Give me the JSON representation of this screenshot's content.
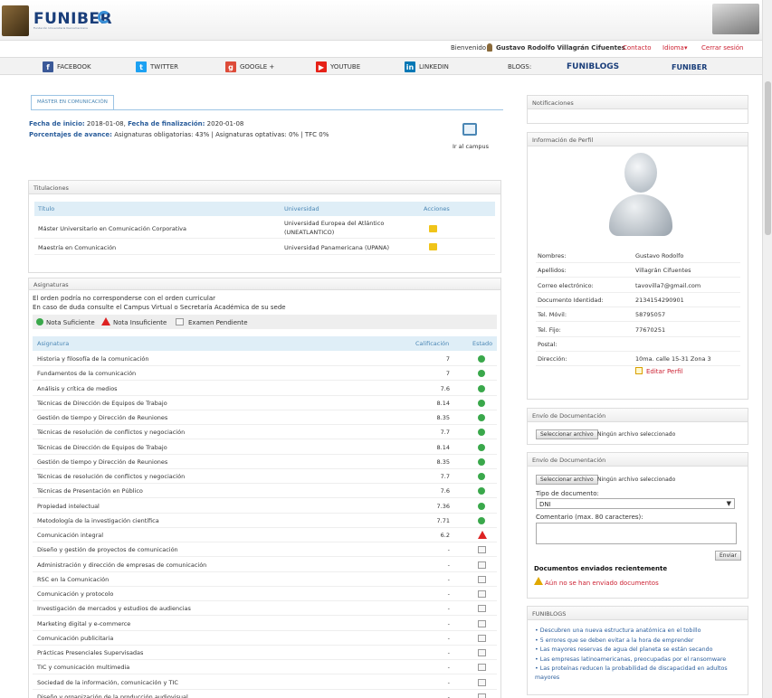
{
  "header": {
    "logo": "FUNIBER",
    "logo_sub": "Fundación Universitaria Iberoamericana",
    "welcome": "Bienvenido",
    "user": "Gustavo Rodolfo Villagrán Cifuentes",
    "contact": "Contacto",
    "language": "Idioma",
    "logout": "Cerrar sesión"
  },
  "social": {
    "facebook": "FACEBOOK",
    "twitter": "TWITTER",
    "google": "GOOGLE +",
    "youtube": "YOUTUBE",
    "linkedin": "LINKEDIN",
    "blogs": "BLOGS:",
    "funiblogs": "FUNIBLOGS",
    "funiber": "FUNIBER"
  },
  "program": {
    "tab": "MÁSTER EN COMUNICACIÓN",
    "start_label": "Fecha de inicio:",
    "start": "2018-01-08,",
    "end_label": "Fecha de finalización:",
    "end": "2020-01-08",
    "progress_label": "Porcentajes de avance:",
    "progress": "Asignaturas obligatorias: 43% | Asignaturas optativas: 0% | TFC 0%",
    "campus": "Ir al campus"
  },
  "titulaciones": {
    "title": "Titulaciones",
    "headers": [
      "Título",
      "Universidad",
      "Acciones"
    ],
    "rows": [
      {
        "titulo": "Máster Universitario en Comunicación Corporativa",
        "uni1": "Universidad Europea del Atlántico",
        "uni2": "(UNEATLANTICO)"
      },
      {
        "titulo": "Maestría en Comunicación",
        "uni1": "Universidad Panamericana (UPANA)",
        "uni2": ""
      }
    ]
  },
  "asignaturas": {
    "title": "Asignaturas",
    "note1": "El orden podría no corresponderse con el orden curricular",
    "note2": "En caso de duda consulte el Campus Virtual o Secretaría Académica de su sede",
    "legend_ok": "Nota Suficiente",
    "legend_bad": "Nota Insuficiente",
    "legend_pend": "Examen Pendiente",
    "headers": [
      "Asignatura",
      "Calificación",
      "Estado"
    ],
    "rows": [
      {
        "name": "Historia y filosofía de la comunicación",
        "grade": "7",
        "status": "ok"
      },
      {
        "name": "Fundamentos de la comunicación",
        "grade": "7",
        "status": "ok"
      },
      {
        "name": "Análisis y crítica de medios",
        "grade": "7.6",
        "status": "ok"
      },
      {
        "name": "Técnicas de Dirección de Equipos de Trabajo",
        "grade": "8.14",
        "status": "ok"
      },
      {
        "name": "Gestión de tiempo y Dirección de Reuniones",
        "grade": "8.35",
        "status": "ok"
      },
      {
        "name": "Técnicas de resolución de conflictos y negociación",
        "grade": "7.7",
        "status": "ok"
      },
      {
        "name": "Técnicas de Dirección de Equipos de Trabajo",
        "grade": "8.14",
        "status": "ok"
      },
      {
        "name": "Gestión de tiempo y Dirección de Reuniones",
        "grade": "8.35",
        "status": "ok"
      },
      {
        "name": "Técnicas de resolución de conflictos y negociación",
        "grade": "7.7",
        "status": "ok"
      },
      {
        "name": "Técnicas de Presentación en Público",
        "grade": "7.6",
        "status": "ok"
      },
      {
        "name": "Propiedad intelectual",
        "grade": "7.36",
        "status": "ok"
      },
      {
        "name": "Metodología de la investigación científica",
        "grade": "7.71",
        "status": "ok"
      },
      {
        "name": "Comunicación integral",
        "grade": "6.2",
        "status": "bad"
      },
      {
        "name": "Diseño y gestión de proyectos de comunicación",
        "grade": "-",
        "status": "pend"
      },
      {
        "name": "Administración y dirección de empresas de comunicación",
        "grade": "-",
        "status": "pend"
      },
      {
        "name": "RSC en la Comunicación",
        "grade": "-",
        "status": "pend"
      },
      {
        "name": "Comunicación y protocolo",
        "grade": "-",
        "status": "pend"
      },
      {
        "name": "Investigación de mercados y estudios de audiencias",
        "grade": "-",
        "status": "pend"
      },
      {
        "name": "Marketing digital y e-commerce",
        "grade": "-",
        "status": "pend"
      },
      {
        "name": "Comunicación publicitaria",
        "grade": "-",
        "status": "pend"
      },
      {
        "name": "Prácticas Presenciales Supervisadas",
        "grade": "-",
        "status": "pend"
      },
      {
        "name": "TIC y comunicación multimedia",
        "grade": "-",
        "status": "pend"
      },
      {
        "name": "Sociedad de la información, comunicación y TIC",
        "grade": "-",
        "status": "pend"
      },
      {
        "name": "Diseño y organización de la producción audiovisual",
        "grade": "-",
        "status": "pend"
      }
    ]
  },
  "notificaciones": {
    "title": "Notificaciones"
  },
  "perfil": {
    "title": "Información de Perfil",
    "fields": [
      {
        "label": "Nombres:",
        "value": "Gustavo Rodolfo"
      },
      {
        "label": "Apellidos:",
        "value": "Villagrán Cifuentes"
      },
      {
        "label": "Correo electrónico:",
        "value": "tavovilla7@gmail.com"
      },
      {
        "label": "Documento Identidad:",
        "value": "2134154290901"
      },
      {
        "label": "Tel. Móvil:",
        "value": "58795057"
      },
      {
        "label": "Tel. Fijo:",
        "value": "77670251"
      },
      {
        "label": "Postal:",
        "value": ""
      },
      {
        "label": "Dirección:",
        "value": "10ma. calle 15-31 Zona 3"
      }
    ],
    "edit": "Editar Perfil"
  },
  "envio1": {
    "title": "Envío de Documentación",
    "select": "Seleccionar archivo",
    "none": "Ningún archivo seleccionado"
  },
  "envio2": {
    "title": "Envío de Documentación",
    "select": "Seleccionar archivo",
    "none": "Ningún archivo seleccionado",
    "tipo_label": "Tipo de documento:",
    "tipo": "DNI",
    "comentario_label": "Comentario (max. 80 caracteres):",
    "send": "Enviar",
    "recent_title": "Documentos enviados recientemente",
    "recent_none": "Aún no se han enviado documentos"
  },
  "funiblogs": {
    "title": "FUNIBLOGS",
    "items": [
      "Descubren una nueva estructura anatómica en el tobillo",
      "5 errores que se deben evitar a la hora de emprender",
      "Las mayores reservas de agua del planeta se están secando",
      "Las empresas latinoamericanas, preocupadas por el ransomware",
      "Las proteínas reducen la probabilidad de discapacidad en adultos mayores"
    ]
  },
  "colors": {
    "brand": "#1a3e7a",
    "link": "#2a5d9b",
    "ok": "#3aa84b",
    "bad": "#dd2222",
    "warn": "#e0a800"
  }
}
